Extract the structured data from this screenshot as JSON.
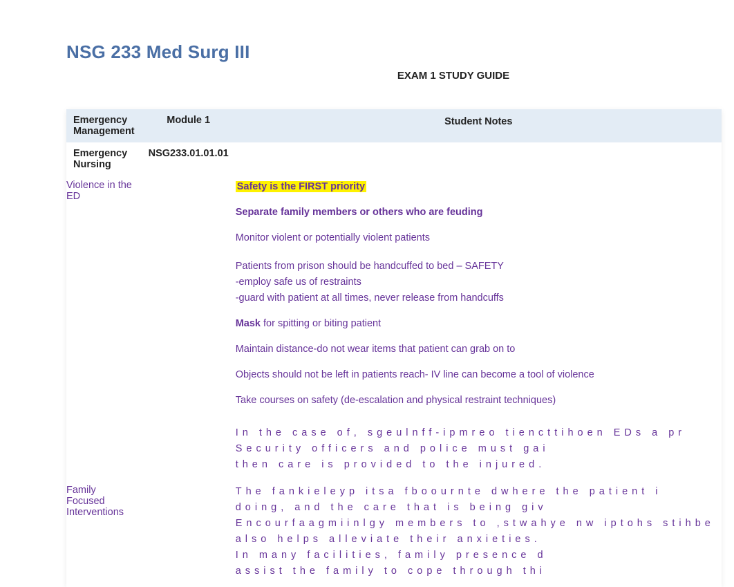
{
  "title": "NSG 233 Med Surg III",
  "subtitle": "EXAM 1 STUDY GUIDE",
  "table": {
    "headers": {
      "col1": "Emergency Management",
      "col2": "Module 1",
      "col3": "Student Notes"
    },
    "row_en": {
      "col1": "Emergency Nursing",
      "col2": "NSG233.01.01.01",
      "col3": ""
    },
    "row_violence": {
      "col1": "Violence in the ED",
      "notes": {
        "l1": "Safety is the FIRST priority",
        "l2": "Separate family members or others who are feuding",
        "l3": "Monitor violent or potentially violent patients",
        "l4": "Patients from prison should be handcuffed to bed – SAFETY",
        "l4b": "-employ safe us of restraints",
        "l4c": "-guard with patient at all times, never release from handcuffs",
        "l5a": "Mask",
        "l5b": " for spitting or biting patient",
        "l6": "Maintain distance-do not wear items that patient can grab on to",
        "l7": "Objects should not be left in patients reach- IV line can become a tool of violence",
        "l8": "Take courses on safety (de-escalation and physical restraint techniques)",
        "w1": "In the case of, sgeulnff-ipmreo tiencttihoen EDs a pr",
        "w2": "Security officers and police must gai",
        "w3": "then care is provided to the injured."
      }
    },
    "row_family": {
      "col1": "Family Focused Interventions",
      "notes": {
        "w1": "The fankieleyp itsa fboournte dwhere the patient i",
        "w2": "doing, and the care that is being giv",
        "w3": " Encourfaagmiinlgy members to ,stwahye nw iptohs stihbe",
        "w4": "also helps alleviate their anxieties.",
        "w5": "In many facilities, family presence d",
        "w6": "assist the family to cope through thi"
      }
    }
  }
}
